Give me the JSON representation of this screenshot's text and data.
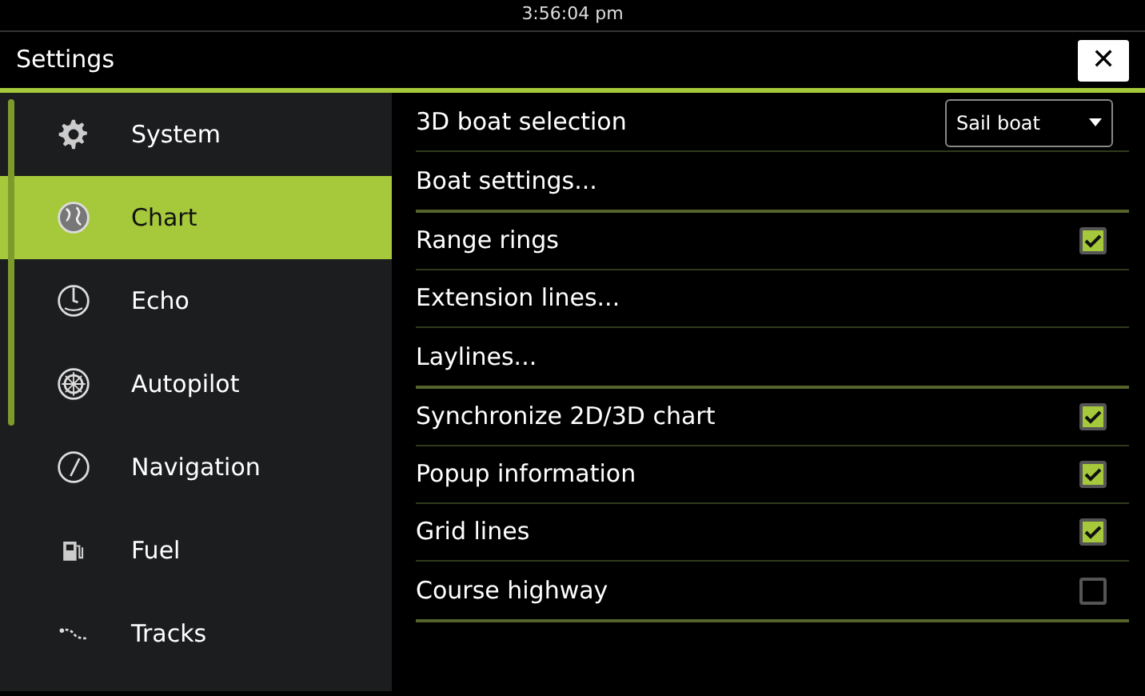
{
  "status_bar": {
    "time": "3:56:04 pm"
  },
  "window": {
    "title": "Settings",
    "close_label": "✕"
  },
  "sidebar": {
    "items": [
      {
        "label": "System",
        "selected": false
      },
      {
        "label": "Chart",
        "selected": true
      },
      {
        "label": "Echo",
        "selected": false
      },
      {
        "label": "Autopilot",
        "selected": false
      },
      {
        "label": "Navigation",
        "selected": false
      },
      {
        "label": "Fuel",
        "selected": false
      },
      {
        "label": "Tracks",
        "selected": false
      }
    ]
  },
  "groups": [
    {
      "rows": [
        {
          "kind": "dropdown",
          "label": "3D boat selection",
          "value": "Sail boat"
        },
        {
          "kind": "link",
          "label": "Boat settings..."
        }
      ]
    },
    {
      "rows": [
        {
          "kind": "checkbox",
          "label": "Range rings",
          "checked": true
        },
        {
          "kind": "link",
          "label": "Extension lines..."
        },
        {
          "kind": "link",
          "label": "Laylines..."
        }
      ]
    },
    {
      "rows": [
        {
          "kind": "checkbox",
          "label": "Synchronize 2D/3D chart",
          "checked": true
        },
        {
          "kind": "checkbox",
          "label": "Popup information",
          "checked": true
        },
        {
          "kind": "checkbox",
          "label": "Grid lines",
          "checked": true
        },
        {
          "kind": "checkbox",
          "label": "Course highway",
          "checked": false
        }
      ]
    }
  ]
}
